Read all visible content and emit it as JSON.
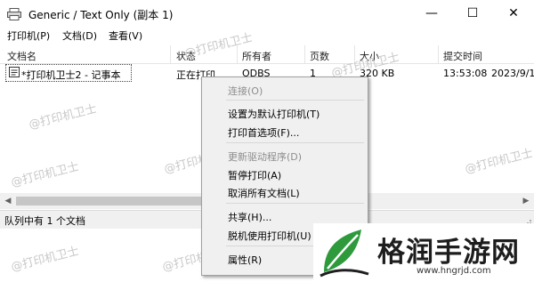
{
  "window": {
    "title": "Generic / Text Only (副本 1)",
    "minimize": "—",
    "maximize": "☐",
    "close": "✕"
  },
  "menu": [
    "打印机(P)",
    "文档(D)",
    "查看(V)"
  ],
  "columns": [
    "文档名",
    "状态",
    "所有者",
    "页数",
    "大小",
    "提交时间"
  ],
  "row": {
    "name": "*打印机卫士2 - 记事本",
    "status": "正在打印",
    "owner": "ODBS",
    "pages": "1",
    "size": "320 KB",
    "time": "13:53:08",
    "date": "2023/9/1"
  },
  "status_bar": "队列中有 1 个文档",
  "context_menu": [
    {
      "label": "连接(O)",
      "disabled": true
    },
    {
      "label": "设置为默认打印机(T)",
      "disabled": false
    },
    {
      "label": "打印首选项(F)...",
      "disabled": false
    },
    {
      "label": "更新驱动程序(D)",
      "disabled": true
    },
    {
      "label": "暂停打印(A)",
      "disabled": false
    },
    {
      "label": "取消所有文档(L)",
      "disabled": false
    },
    {
      "label": "共享(H)...",
      "disabled": false
    },
    {
      "label": "脱机使用打印机(U)",
      "disabled": false
    },
    {
      "label": "属性(R)",
      "disabled": false
    }
  ],
  "watermark": "@打印机卫士",
  "logo": {
    "name": "格润手游网",
    "url": "www.hngrjd.com"
  },
  "colors": {
    "logo_green": "#2e9a3c",
    "disabled_text": "#8d8d8d",
    "menu_bg": "#f0f0f0"
  }
}
